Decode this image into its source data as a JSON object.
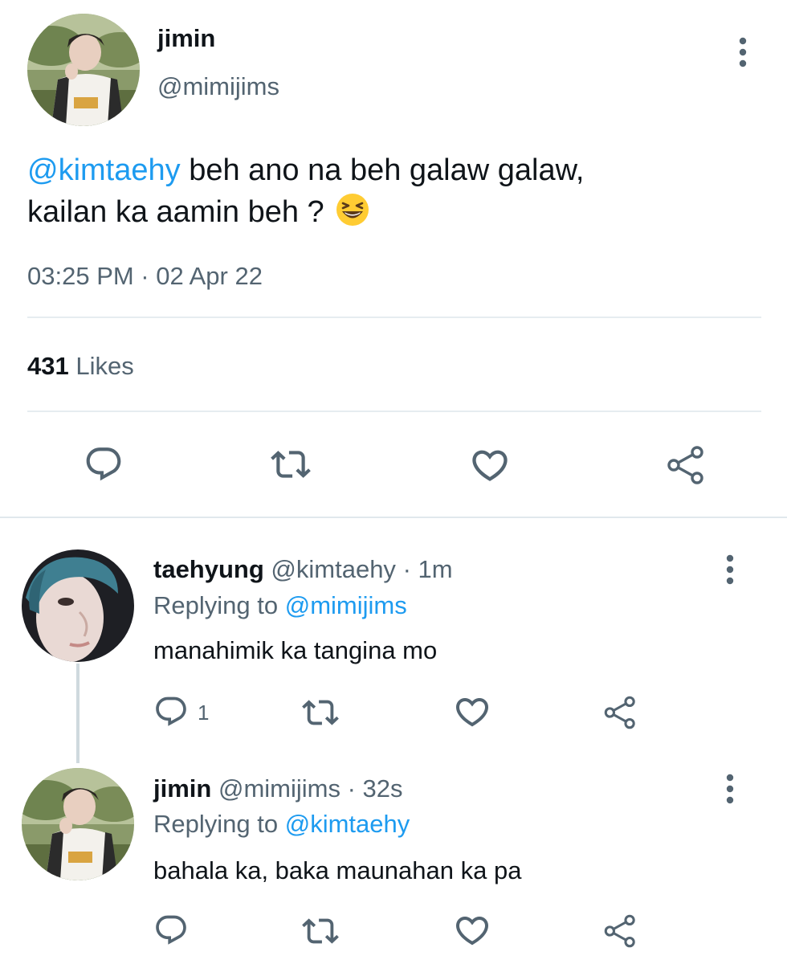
{
  "main_tweet": {
    "display_name": "jimin",
    "handle": "@mimijims",
    "mention": "@kimtaehy",
    "text_line1": " beh ano na beh galaw galaw,",
    "text_line2": "kailan ka aamin beh ?",
    "emoji": "grinning-squinting-face",
    "timestamp": "03:25 PM · 02 Apr 22",
    "likes_count": "431",
    "likes_label": "Likes",
    "actions": [
      "reply-icon",
      "retweet-icon",
      "like-icon",
      "share-icon"
    ]
  },
  "replies": [
    {
      "display_name": "taehyung",
      "handle": "@kimtaehy",
      "time": "· 1m",
      "replying_label": "Replying to",
      "replying_to": "@mimijims",
      "text": "manahimik ka tangina mo",
      "reply_count": "1"
    },
    {
      "display_name": "jimin",
      "handle": "@mimijims",
      "time": "· 32s",
      "replying_label": "Replying to",
      "replying_to": "@kimtaehy",
      "text": "bahala ka, baka maunahan ka pa",
      "reply_count": ""
    }
  ],
  "colors": {
    "accent": "#1d9bf0",
    "muted": "#536471",
    "icon": "#536471",
    "divider": "#e6ecf0"
  }
}
